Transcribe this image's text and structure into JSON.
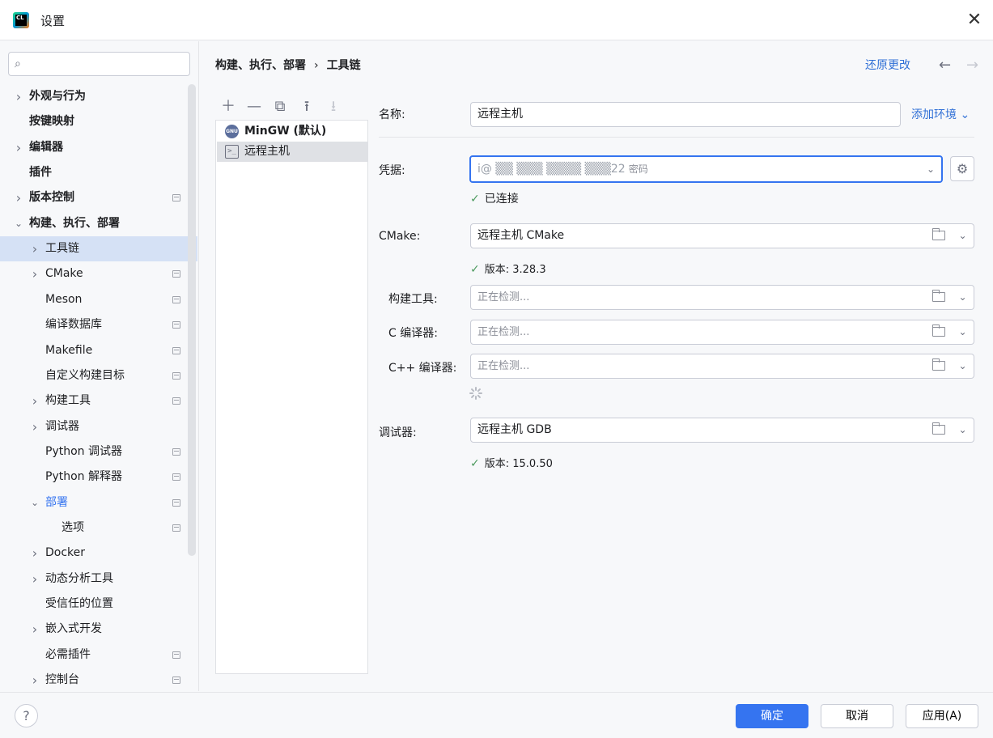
{
  "window": {
    "title": "设置",
    "logo_text": "CL"
  },
  "search": {
    "placeholder": "",
    "value": ""
  },
  "sidebar": {
    "items": [
      {
        "label": "外观与行为",
        "level": 0,
        "chevron": "right",
        "bold": true,
        "project": false
      },
      {
        "label": "按键映射",
        "level": 0,
        "chevron": "",
        "bold": true,
        "project": false
      },
      {
        "label": "编辑器",
        "level": 0,
        "chevron": "right",
        "bold": true,
        "project": false
      },
      {
        "label": "插件",
        "level": 0,
        "chevron": "",
        "bold": true,
        "project": false
      },
      {
        "label": "版本控制",
        "level": 0,
        "chevron": "right",
        "bold": true,
        "project": true
      },
      {
        "label": "构建、执行、部署",
        "level": 0,
        "chevron": "down",
        "bold": true,
        "project": false
      },
      {
        "label": "工具链",
        "level": 1,
        "chevron": "right",
        "bold": false,
        "project": false,
        "selected": true
      },
      {
        "label": "CMake",
        "level": 1,
        "chevron": "right",
        "bold": false,
        "project": true
      },
      {
        "label": "Meson",
        "level": 1,
        "chevron": "",
        "bold": false,
        "project": true
      },
      {
        "label": "编译数据库",
        "level": 1,
        "chevron": "",
        "bold": false,
        "project": true
      },
      {
        "label": "Makefile",
        "level": 1,
        "chevron": "",
        "bold": false,
        "project": true
      },
      {
        "label": "自定义构建目标",
        "level": 1,
        "chevron": "",
        "bold": false,
        "project": true
      },
      {
        "label": "构建工具",
        "level": 1,
        "chevron": "right",
        "bold": false,
        "project": true
      },
      {
        "label": "调试器",
        "level": 1,
        "chevron": "right",
        "bold": false,
        "project": false
      },
      {
        "label": "Python 调试器",
        "level": 1,
        "chevron": "",
        "bold": false,
        "project": true
      },
      {
        "label": "Python 解释器",
        "level": 1,
        "chevron": "",
        "bold": false,
        "project": true
      },
      {
        "label": "部署",
        "level": 1,
        "chevron": "down",
        "bold": false,
        "project": true,
        "blue": true
      },
      {
        "label": "选项",
        "level": 2,
        "chevron": "",
        "bold": false,
        "project": true
      },
      {
        "label": "Docker",
        "level": 1,
        "chevron": "right",
        "bold": false,
        "project": false
      },
      {
        "label": "动态分析工具",
        "level": 1,
        "chevron": "right",
        "bold": false,
        "project": false
      },
      {
        "label": "受信任的位置",
        "level": 1,
        "chevron": "",
        "bold": false,
        "project": false
      },
      {
        "label": "嵌入式开发",
        "level": 1,
        "chevron": "right",
        "bold": false,
        "project": false
      },
      {
        "label": "必需插件",
        "level": 1,
        "chevron": "",
        "bold": false,
        "project": true
      },
      {
        "label": "控制台",
        "level": 1,
        "chevron": "right",
        "bold": false,
        "project": true
      }
    ]
  },
  "header": {
    "breadcrumb": [
      "构建、执行、部署",
      "工具链"
    ],
    "breadcrumb_sep": "›",
    "revert": "还原更改",
    "back_icon": "arrow-left-icon",
    "forward_icon": "arrow-right-icon"
  },
  "toolchains": {
    "toolbar": [
      "add-icon",
      "remove-icon",
      "copy-icon",
      "move-up-icon",
      "move-down-icon"
    ],
    "items": [
      {
        "name": "MinGW (默认)",
        "icon": "gnu-icon",
        "icon_text": "GNU",
        "bold": true
      },
      {
        "name": "远程主机",
        "icon": "terminal-icon",
        "icon_text": ">_",
        "selected": true
      }
    ]
  },
  "form": {
    "name_label": "名称:",
    "name_value": "远程主机",
    "add_env": "添加环境",
    "credentials_label": "凭据:",
    "credentials_value": "i@ ▒▒ ▒▒▒ ▒▒▒▒ ▒▒▒22",
    "credentials_hint": "密码",
    "connected": "已连接",
    "cmake_label": "CMake:",
    "cmake_value": "远程主机 CMake",
    "cmake_version": "版本: 3.28.3",
    "build_tool_label": "构建工具:",
    "build_tool_placeholder": "正在检测...",
    "c_compiler_label": "C 编译器:",
    "c_compiler_placeholder": "正在检测...",
    "cpp_compiler_label": "C++ 编译器:",
    "cpp_compiler_placeholder": "正在检测...",
    "debugger_label": "调试器:",
    "debugger_value": "远程主机 GDB",
    "debugger_version": "版本: 15.0.50"
  },
  "footer": {
    "help": "?",
    "ok": "确定",
    "cancel": "取消",
    "apply": "应用(A)"
  },
  "colors": {
    "accent": "#3574f0",
    "link": "#2f6fd6",
    "success": "#4c9a5e",
    "selection": "#d5e1f5"
  }
}
